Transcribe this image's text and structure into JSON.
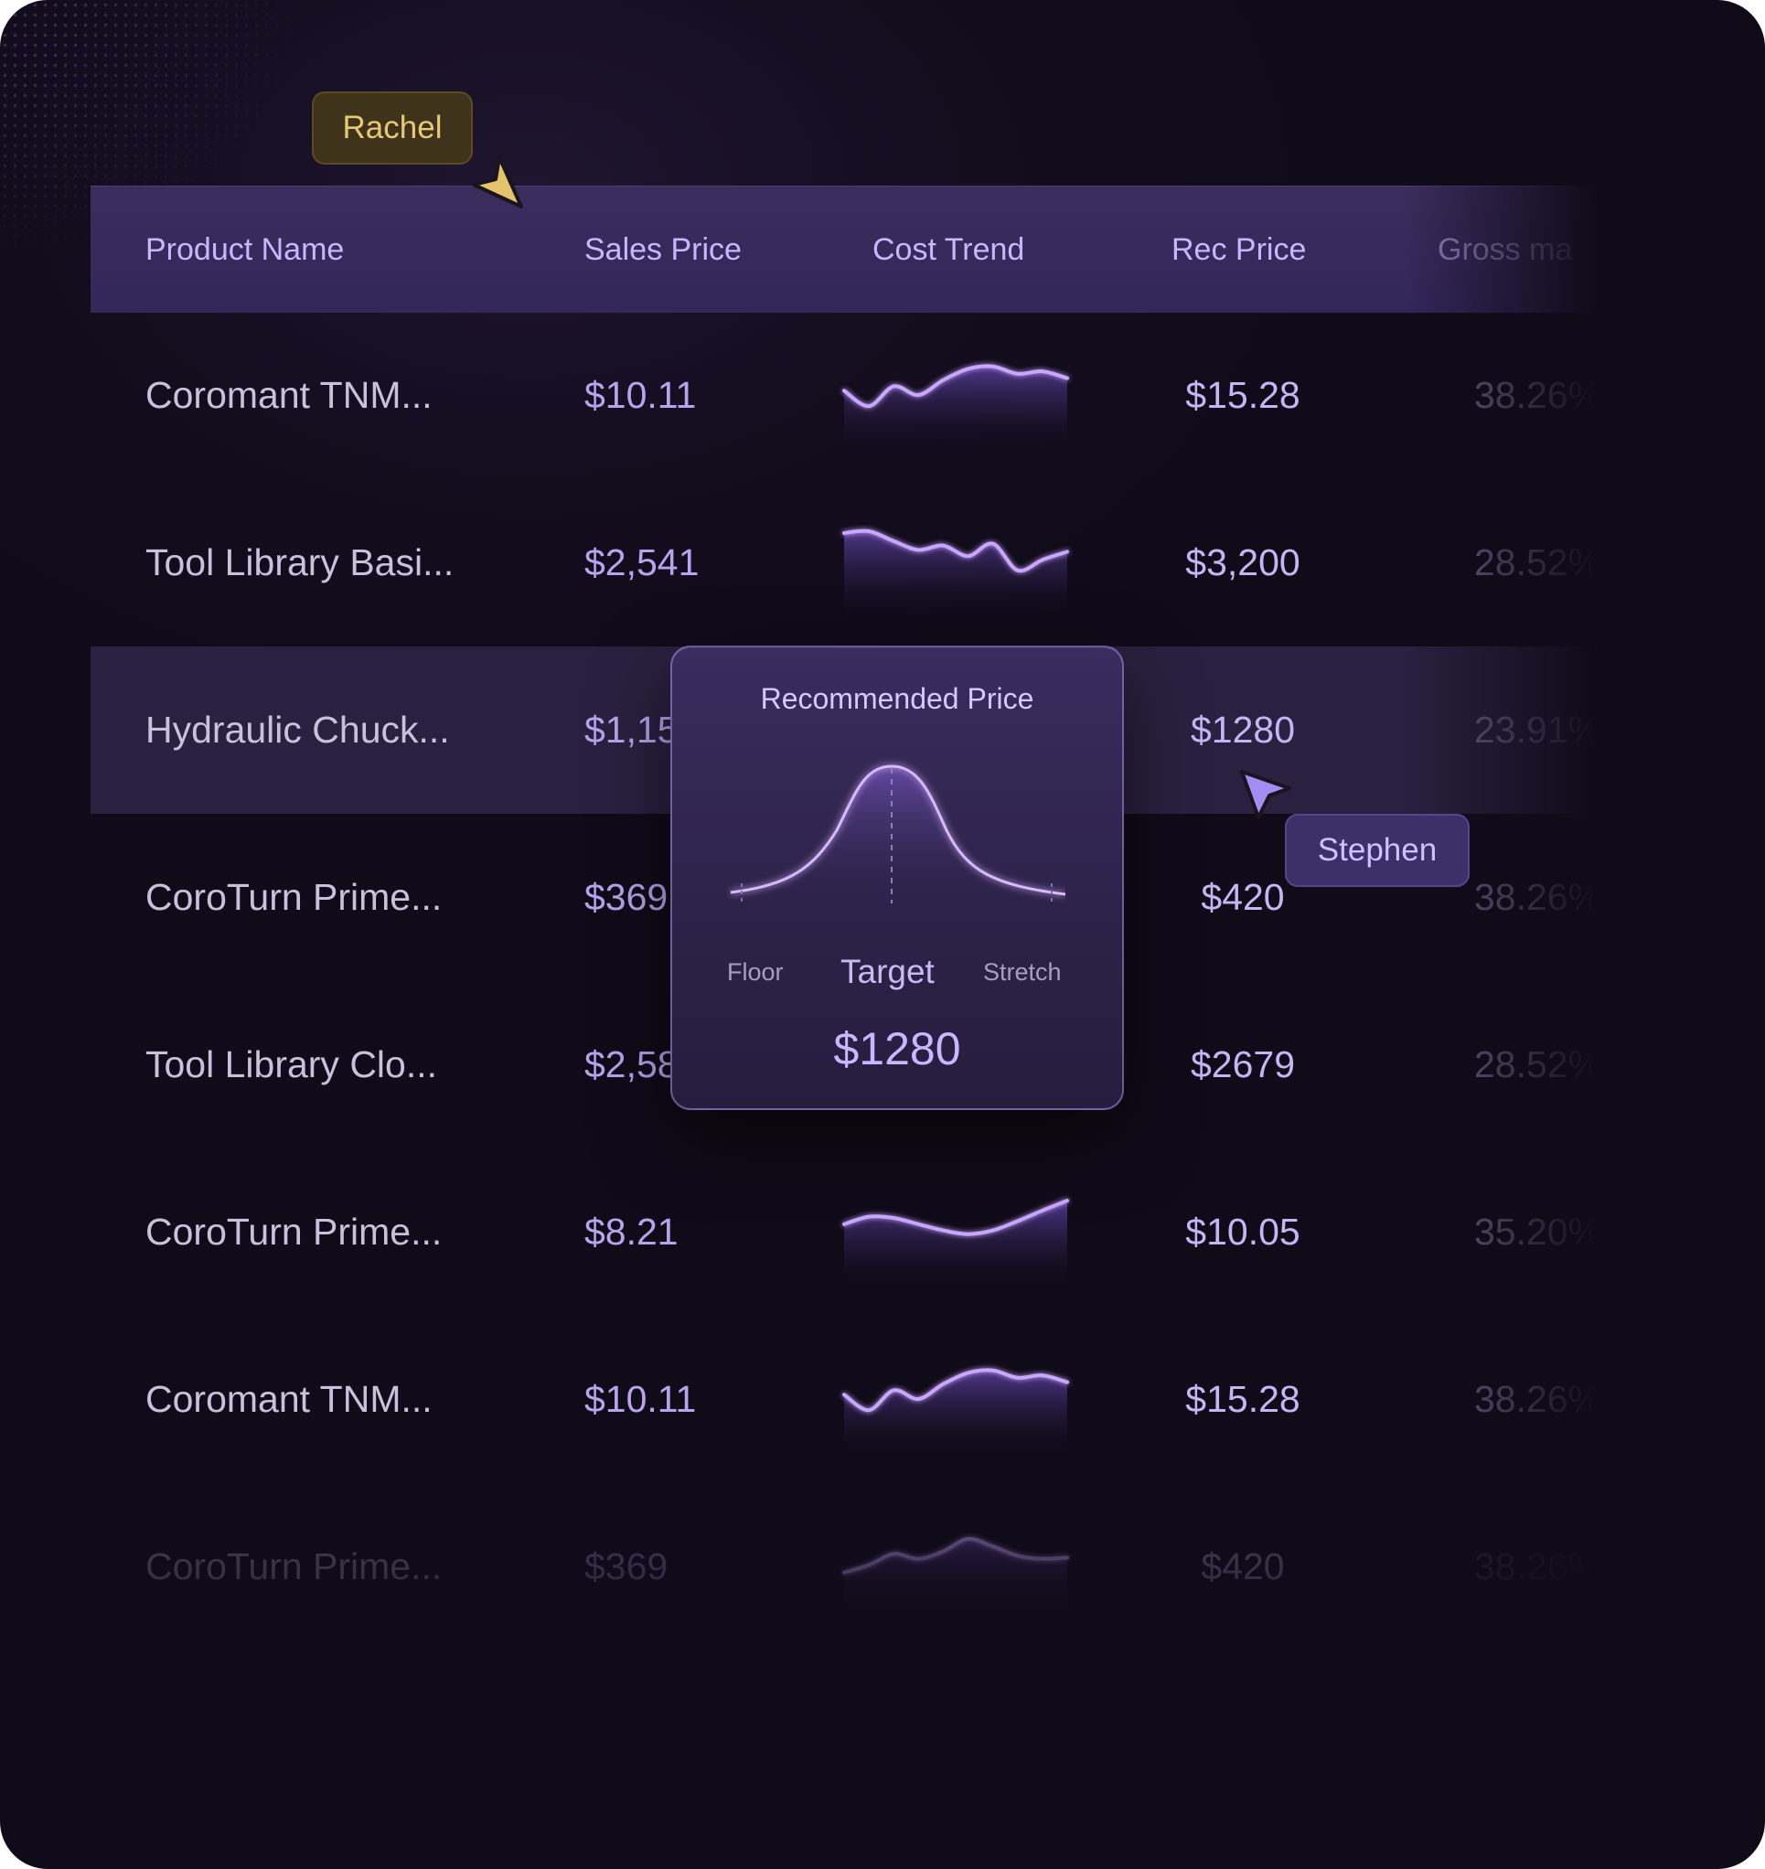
{
  "table": {
    "headers": {
      "product": "Product Name",
      "sales": "Sales Price",
      "cost": "Cost Trend",
      "rec": "Rec Price",
      "gross": "Gross ma"
    },
    "rows": [
      {
        "product": "Coromant TNM...",
        "sales": "$10.11",
        "rec": "$15.28",
        "gross": "38.26%",
        "trend": [
          0.35,
          0.1,
          0.42,
          0.28,
          0.52,
          0.7,
          0.74,
          0.62,
          0.66,
          0.55
        ]
      },
      {
        "product": "Tool Library Basi...",
        "sales": "$2,541",
        "rec": "$3,200",
        "gross": "28.52%",
        "trend": [
          0.75,
          0.78,
          0.62,
          0.48,
          0.55,
          0.38,
          0.58,
          0.15,
          0.32,
          0.45
        ]
      },
      {
        "product": "Hydraulic Chuck...",
        "sales": "$1,15",
        "rec": "$1280",
        "gross": "23.91%",
        "trend": []
      },
      {
        "product": "CoroTurn Prime...",
        "sales": "$369",
        "rec": "$420",
        "gross": "38.26%",
        "trend": []
      },
      {
        "product": "Tool Library Clo...",
        "sales": "$2,58",
        "rec": "$2679",
        "gross": "28.52%",
        "trend": []
      },
      {
        "product": "CoroTurn Prime...",
        "sales": "$8.21",
        "rec": "$10.05",
        "gross": "35.20%",
        "trend": [
          0.4,
          0.52,
          0.5,
          0.4,
          0.3,
          0.24,
          0.3,
          0.45,
          0.62,
          0.78
        ]
      },
      {
        "product": "Coromant TNM...",
        "sales": "$10.11",
        "rec": "$15.28",
        "gross": "38.26%",
        "trend": [
          0.35,
          0.1,
          0.42,
          0.28,
          0.52,
          0.7,
          0.74,
          0.62,
          0.66,
          0.55
        ]
      },
      {
        "product": "CoroTurn Prime...",
        "sales": "$369",
        "rec": "$420",
        "gross": "38.26%",
        "trend": [
          0.18,
          0.3,
          0.48,
          0.4,
          0.52,
          0.72,
          0.6,
          0.45,
          0.4,
          0.42
        ]
      }
    ]
  },
  "popover": {
    "title": "Recommended Price",
    "labels": {
      "floor": "Floor",
      "target": "Target",
      "stretch": "Stretch"
    },
    "price": "$1280"
  },
  "cursors": {
    "rachel": {
      "name": "Rachel",
      "color": "#e7c877"
    },
    "stephen": {
      "name": "Stephen",
      "color": "#a58cf2"
    }
  },
  "colors": {
    "accent": "#b79cff",
    "header_bg": "#372a5a",
    "highlight_row": "#2a2140",
    "background": "#120c1c"
  }
}
